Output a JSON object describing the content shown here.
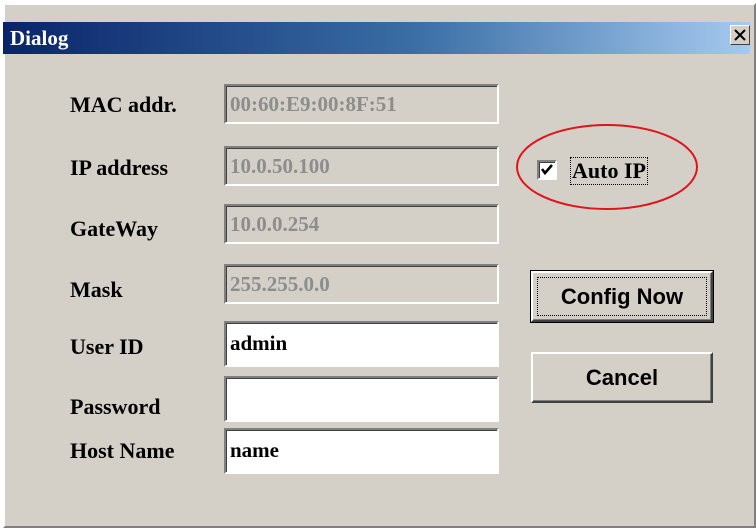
{
  "window": {
    "title": "Dialog",
    "close_label": "close"
  },
  "form": {
    "mac_label": "MAC addr.",
    "mac_value": "00:60:E9:00:8F:51",
    "ip_label": "IP address",
    "ip_value": "10.0.50.100",
    "gateway_label": "GateWay",
    "gateway_value": "10.0.0.254",
    "mask_label": "Mask",
    "mask_value": "255.255.0.0",
    "userid_label": "User ID",
    "userid_value": "admin",
    "password_label": "Password",
    "password_value": "",
    "hostname_label": "Host Name",
    "hostname_value": "name"
  },
  "options": {
    "auto_ip_label": "Auto IP",
    "auto_ip_checked": true,
    "highlight_color": "#e0141b"
  },
  "buttons": {
    "config_label": "Config Now",
    "cancel_label": "Cancel"
  }
}
